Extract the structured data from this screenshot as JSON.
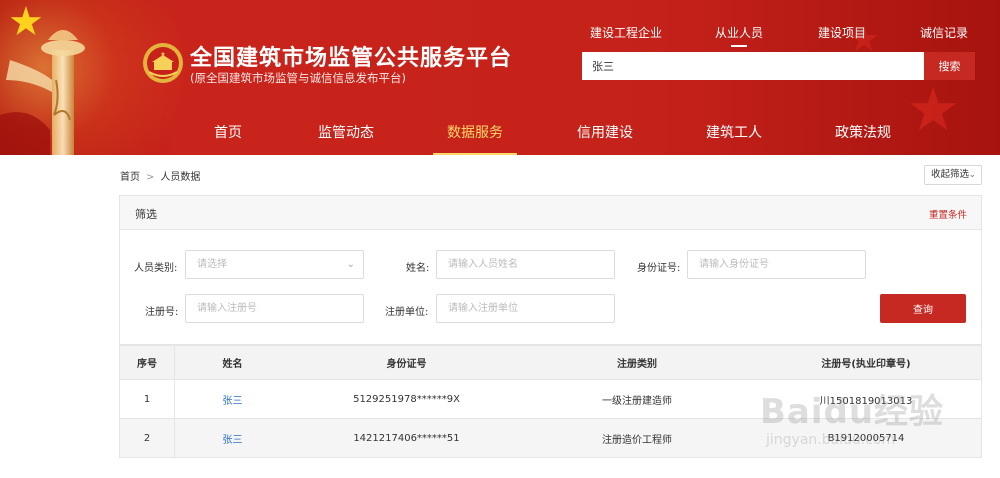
{
  "header": {
    "title": "全国建筑市场监管公共服务平台",
    "subtitle": "(原全国建筑市场监管与诚信信息发布平台)",
    "top_links": [
      "建设工程企业",
      "从业人员",
      "建设项目",
      "诚信记录"
    ],
    "active_top_link": "从业人员",
    "search_value": "张三",
    "search_button": "搜索",
    "nav": [
      "首页",
      "监管动态",
      "数据服务",
      "信用建设",
      "建筑工人",
      "政策法规"
    ],
    "active_nav": "数据服务",
    "colors": {
      "primary_red": "#c62822",
      "nav_active": "#ffd76a"
    }
  },
  "breadcrumb": {
    "home": "首页",
    "current": "人员数据"
  },
  "collapse_label": "收起筛选",
  "filter": {
    "title": "筛选",
    "reset_label": "重置条件",
    "category_label": "人员类别:",
    "category_placeholder": "请选择",
    "name_label": "姓名:",
    "name_placeholder": "请输入人员姓名",
    "id_label": "身份证号:",
    "id_placeholder": "请输入身份证号",
    "reg_label": "注册号:",
    "reg_placeholder": "请输入注册号",
    "unit_label": "注册单位:",
    "unit_placeholder": "请输入注册单位",
    "query_button": "查询"
  },
  "table": {
    "headers": [
      "序号",
      "姓名",
      "身份证号",
      "注册类别",
      "注册号(执业印章号)"
    ],
    "rows": [
      [
        "1",
        "张三",
        "5129251978******9X",
        "一级注册建造师",
        "川1501819013013"
      ],
      [
        "2",
        "张三",
        "1421217406******51",
        "注册造价工程师",
        "B19120005714"
      ]
    ]
  },
  "watermark": {
    "text": "Baidu经验",
    "url": "jingyan.baidu.com"
  }
}
